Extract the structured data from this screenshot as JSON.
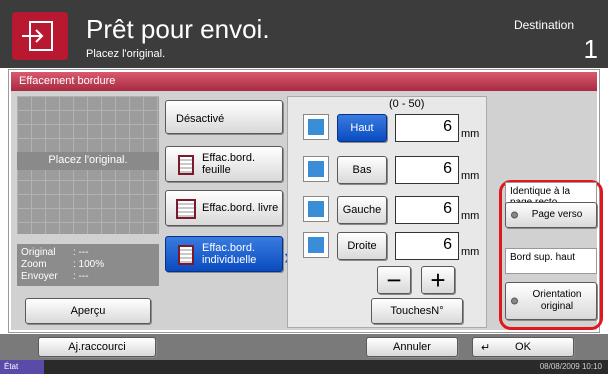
{
  "header": {
    "title": "Prêt pour envoi.",
    "subtitle": "Placez l'original.",
    "destination_label": "Destination",
    "destination_count": "1"
  },
  "panel": {
    "title": "Effacement bordure",
    "preview_label": "Placez l'original.",
    "info": [
      {
        "label": "Original",
        "value": ": ---"
      },
      {
        "label": "Zoom",
        "value": ": 100%"
      },
      {
        "label": "Envoyer",
        "value": ": ---"
      }
    ],
    "preview_button": "Aperçu"
  },
  "options": [
    {
      "label": "Désactivé",
      "active": false
    },
    {
      "label": "Effac.bord. feuille",
      "active": false
    },
    {
      "label": "Effac.bord. livre",
      "active": false
    },
    {
      "label": "Effac.bord. individuelle",
      "active": true
    }
  ],
  "margins": {
    "range": "(0 - 50)",
    "unit": "mm",
    "rows": [
      {
        "label": "Haut",
        "value": "6",
        "selected": true
      },
      {
        "label": "Bas",
        "value": "6",
        "selected": false
      },
      {
        "label": "Gauche",
        "value": "6",
        "selected": false
      },
      {
        "label": "Droite",
        "value": "6",
        "selected": false
      }
    ],
    "minus": "−",
    "plus": "+",
    "numkeys": "TouchesN°"
  },
  "back_page": {
    "label": "Identique à la page recto",
    "button": "Page verso"
  },
  "binding": {
    "label": "Bord sup. haut",
    "button": "Orientation original"
  },
  "footer": {
    "shortcut": "Aj.raccourci",
    "cancel": "Annuler",
    "ok": "OK",
    "status": "État",
    "datetime": "08/08/2009   10:10"
  },
  "colors": {
    "header_bg": "#3c3c3c",
    "accent_red": "#b81830",
    "selected_blue": "#0a4cc0",
    "highlight_ring": "#e0181e"
  }
}
